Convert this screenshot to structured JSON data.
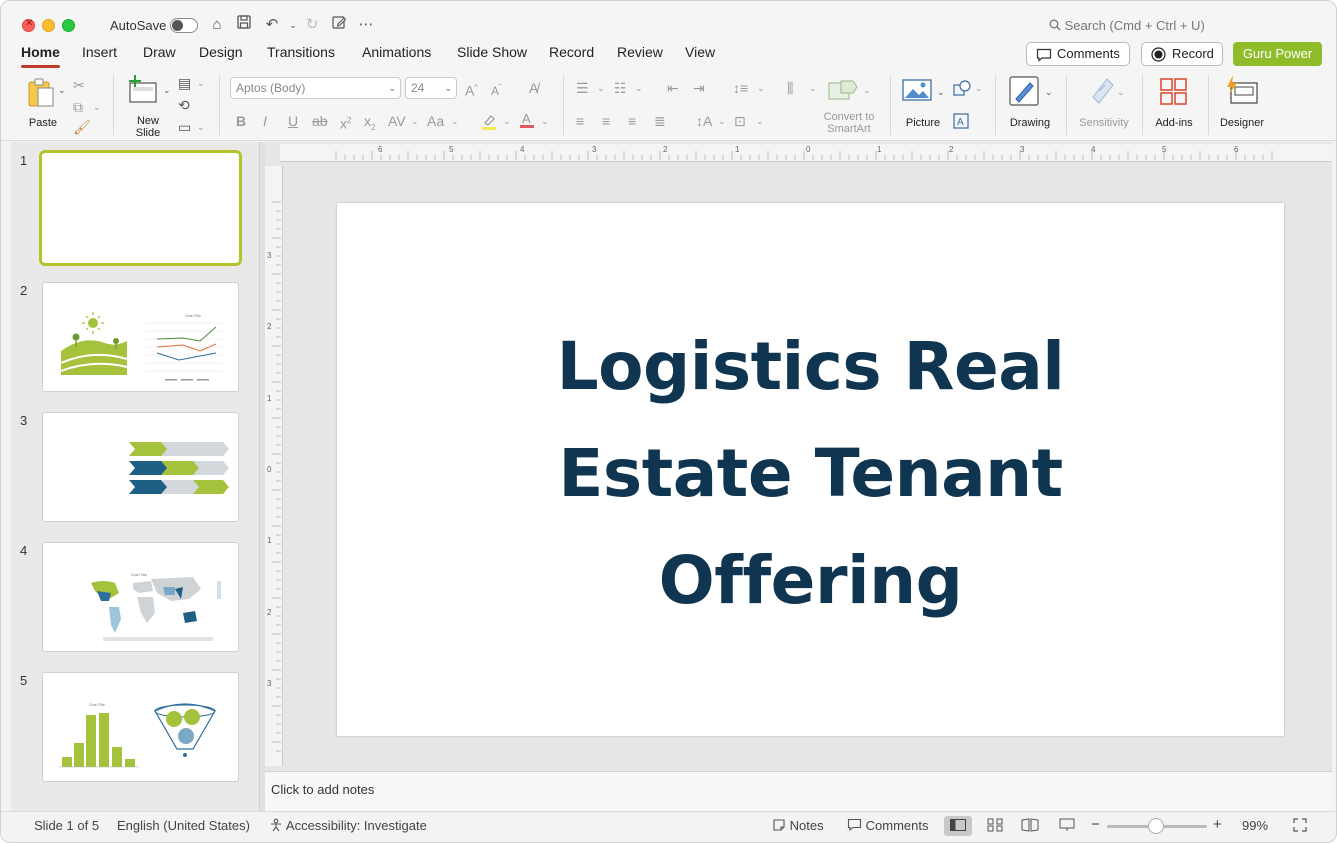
{
  "titlebar": {
    "autosave_label": "AutoSave",
    "search_placeholder": "Search (Cmd + Ctrl + U)"
  },
  "tabs": [
    {
      "label": "Home",
      "active": true
    },
    {
      "label": "Insert"
    },
    {
      "label": "Draw"
    },
    {
      "label": "Design"
    },
    {
      "label": "Transitions"
    },
    {
      "label": "Animations"
    },
    {
      "label": "Slide Show"
    },
    {
      "label": "Record"
    },
    {
      "label": "Review"
    },
    {
      "label": "View"
    }
  ],
  "header_buttons": {
    "comments": "Comments",
    "record": "Record",
    "guru": "Guru Power",
    "guru_color": "#8fbc2a"
  },
  "ribbon": {
    "paste": "Paste",
    "new_slide": "New Slide",
    "new_slide_line1": "New",
    "new_slide_line2": "Slide",
    "font_name": "Aptos (Body)",
    "font_size": "24",
    "convert_line1": "Convert to",
    "convert_line2": "SmartArt",
    "picture": "Picture",
    "drawing": "Drawing",
    "sensitivity": "Sensitivity",
    "addins": "Add-ins",
    "designer": "Designer"
  },
  "slides_panel": {
    "numbers": [
      "1",
      "2",
      "3",
      "4",
      "5"
    ],
    "thumb2_chart_title": "Chart Title",
    "thumb4_chart_title": "Chart Title",
    "thumb5_chart_title": "Chart Title"
  },
  "slide": {
    "title_line1": "Logistics Real",
    "title_line2": "Estate Tenant",
    "title_line3": "Offering",
    "title_color": "#0f3550"
  },
  "ruler": {
    "h_ticks": [
      "6",
      "5",
      "4",
      "3",
      "2",
      "1",
      "0",
      "1",
      "2",
      "3",
      "4",
      "5",
      "6"
    ],
    "v_ticks": [
      "3",
      "2",
      "1",
      "0",
      "1",
      "2",
      "3"
    ]
  },
  "notes": {
    "placeholder": "Click to add notes"
  },
  "status": {
    "slide_of": "Slide 1 of 5",
    "language": "English (United States)",
    "accessibility": "Accessibility: Investigate",
    "notes": "Notes",
    "comments": "Comments",
    "zoom": "99%"
  }
}
